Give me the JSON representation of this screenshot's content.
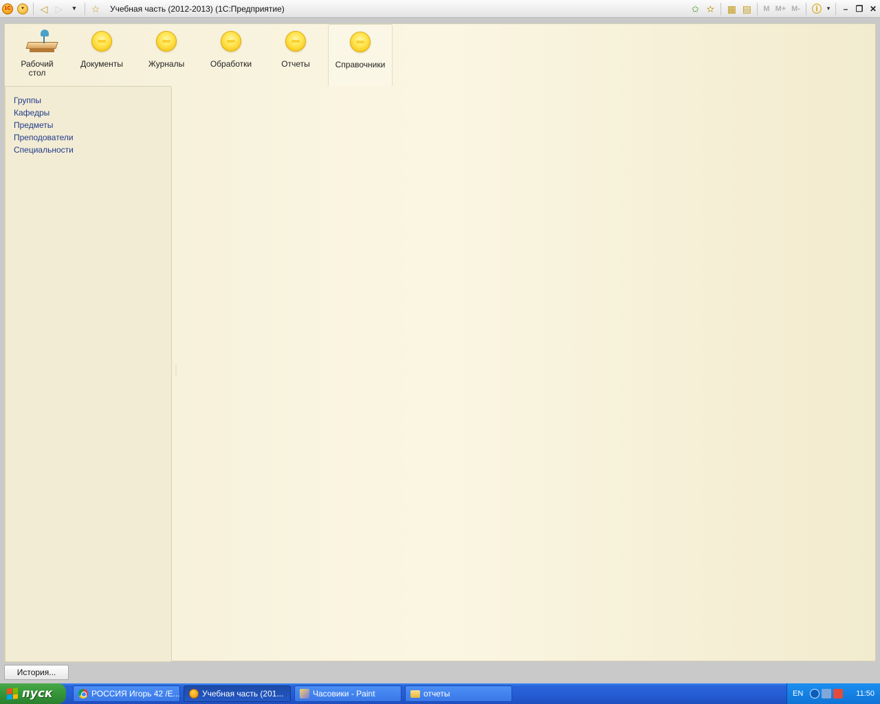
{
  "window": {
    "title": "Учебная часть (2012-2013)  (1С:Предприятие)",
    "logo_text": "1С"
  },
  "toolbar_right": {
    "memory_buttons": [
      "M",
      "M+",
      "M-"
    ]
  },
  "sections": [
    {
      "label": "Рабочий стол",
      "icon": "desktop-icon",
      "active": false
    },
    {
      "label": "Документы",
      "icon": "yellow-ball-icon",
      "active": false
    },
    {
      "label": "Журналы",
      "icon": "yellow-ball-icon",
      "active": false
    },
    {
      "label": "Обработки",
      "icon": "yellow-ball-icon",
      "active": false
    },
    {
      "label": "Отчеты",
      "icon": "yellow-ball-icon",
      "active": false
    },
    {
      "label": "Справочники",
      "icon": "yellow-ball-icon",
      "active": true
    }
  ],
  "nav": {
    "items": [
      {
        "label": "Группы"
      },
      {
        "label": "Кафедры"
      },
      {
        "label": "Предметы"
      },
      {
        "label": "Преподователи"
      },
      {
        "label": "Специальности"
      }
    ]
  },
  "history_button": "История...",
  "taskbar": {
    "start_label": "пуск",
    "tasks": [
      {
        "label": "РОССИЯ Игорь 42 /Е...",
        "icon": "chrome-icon",
        "active": false
      },
      {
        "label": "Учебная часть (201...",
        "icon": "1c-icon",
        "active": true
      },
      {
        "label": "Часовики - Paint",
        "icon": "paint-icon",
        "active": false
      },
      {
        "label": "отчеты",
        "icon": "folder-icon",
        "active": false
      }
    ],
    "language": "EN",
    "clock": "11:50"
  },
  "colors": {
    "app_background": "#fbf6e2",
    "nav_link": "#1e3a8a",
    "taskbar": "#245dd6",
    "start_button": "#37993a"
  }
}
